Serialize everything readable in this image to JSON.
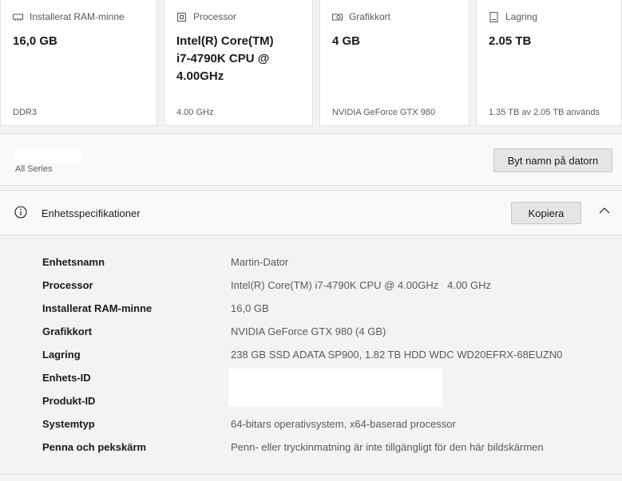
{
  "cards": [
    {
      "id": "ram",
      "icon": "ram-icon",
      "title": "Installerat RAM-minne",
      "value_lines": [
        "16,0 GB"
      ],
      "sub": "DDR3"
    },
    {
      "id": "cpu",
      "icon": "processor-icon",
      "title": "Processor",
      "value_lines": [
        "Intel(R) Core(TM)",
        "i7-4790K CPU @",
        "4.00GHz"
      ],
      "sub": "4.00 GHz"
    },
    {
      "id": "gpu",
      "icon": "graphics-card-icon",
      "title": "Grafikkort",
      "value_lines": [
        "4 GB"
      ],
      "sub": "NVIDIA GeForce GTX 980"
    },
    {
      "id": "storage",
      "icon": "storage-icon",
      "title": "Lagring",
      "value_lines": [
        "2.05 TB"
      ],
      "sub": "1.35 TB av 2.05 TB används"
    }
  ],
  "device": {
    "model": "All Series",
    "rename_button": "Byt namn på datorn"
  },
  "specs": {
    "title": "Enhetsspecifikationer",
    "copy_button": "Kopiera",
    "rows": [
      {
        "label": "Enhetsnamn",
        "value": "Martin-Dator"
      },
      {
        "label": "Processor",
        "value": "Intel(R) Core(TM) i7-4790K CPU @ 4.00GHz   4.00 GHz"
      },
      {
        "label": "Installerat RAM-minne",
        "value": "16,0 GB"
      },
      {
        "label": "Grafikkort",
        "value": "NVIDIA GeForce GTX 980 (4 GB)"
      },
      {
        "label": "Lagring",
        "value": "238 GB SSD ADATA SP900, 1.82 TB HDD WDC WD20EFRX-68EUZN0"
      },
      {
        "label": "Enhets-ID",
        "value": ""
      },
      {
        "label": "Produkt-ID",
        "value": ""
      },
      {
        "label": "Systemtyp",
        "value": "64-bitars operativsystem, x64-baserad processor"
      },
      {
        "label": "Penna och pekskärm",
        "value": "Penn- eller tryckinmatning är inte tillgängligt för den här bildskärmen"
      }
    ]
  }
}
